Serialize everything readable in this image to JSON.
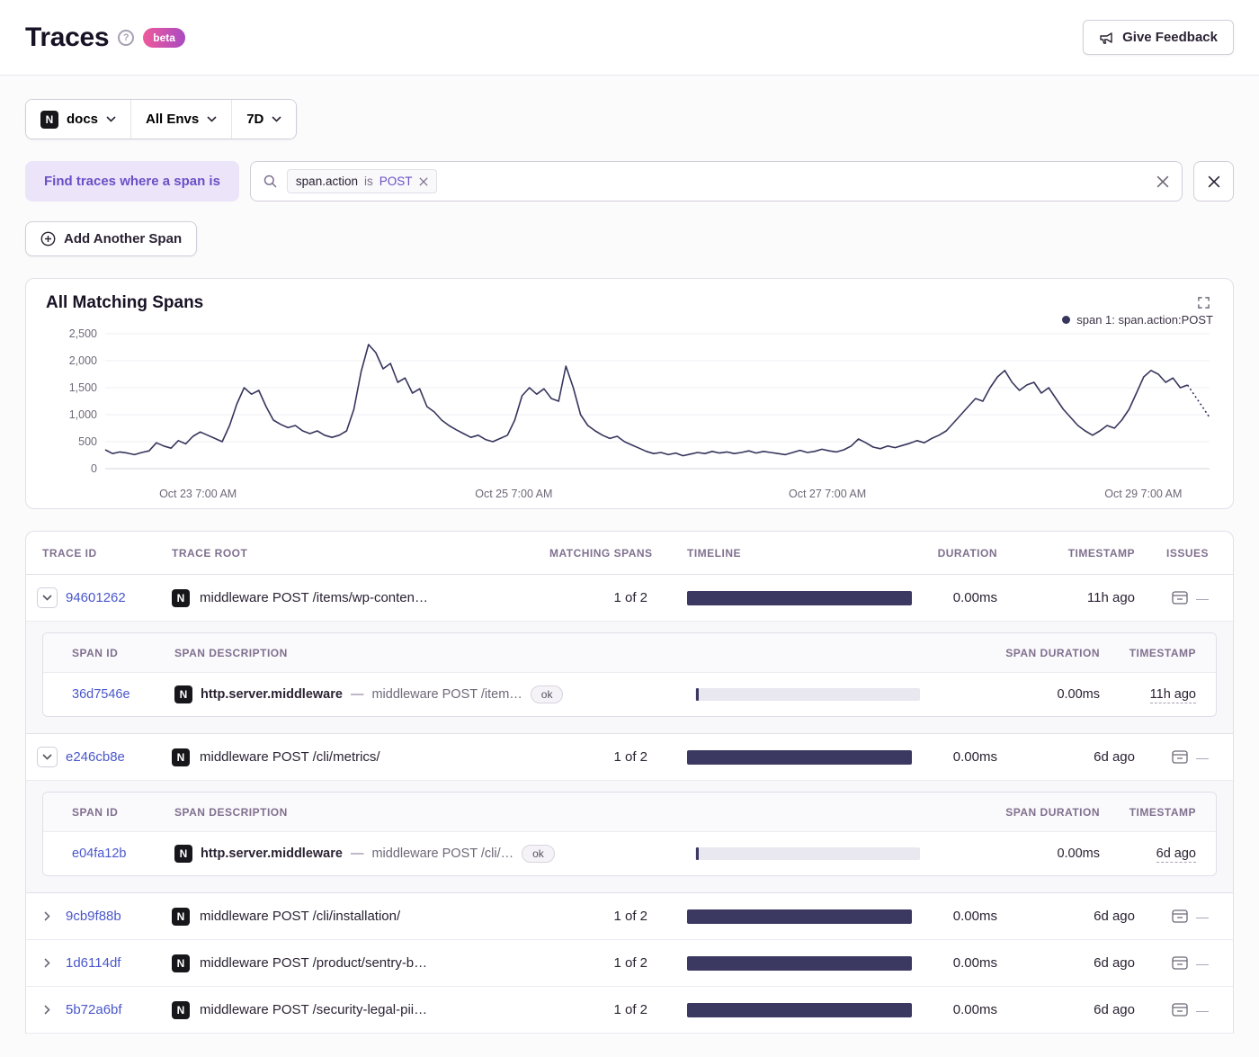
{
  "header": {
    "title": "Traces",
    "beta": "beta",
    "feedback": "Give Feedback"
  },
  "icons": {
    "help": "?",
    "project_letter": "N"
  },
  "filters": {
    "project": "docs",
    "env": "All Envs",
    "range": "7D"
  },
  "span_query": {
    "label": "Find traces where a span is",
    "token": {
      "key": "span.action",
      "op": "is",
      "value": "POST"
    },
    "add_span": "Add Another Span"
  },
  "chart": {
    "title": "All Matching Spans",
    "legend": "span 1: span.action:POST"
  },
  "chart_data": {
    "type": "line",
    "title": "All Matching Spans",
    "xlabel": "",
    "ylabel": "",
    "ylim": [
      0,
      2500
    ],
    "grid": true,
    "legend_position": "top-right",
    "color": "#36355c",
    "y_ticks": [
      0,
      500,
      1000,
      1500,
      2000,
      2500
    ],
    "y_tick_labels": [
      "0",
      "500",
      "1,000",
      "1,500",
      "2,000",
      "2,500"
    ],
    "x_tick_labels": [
      "Oct 23 7:00 AM",
      "Oct 25 7:00 AM",
      "Oct 27 7:00 AM",
      "Oct 29 7:00 AM"
    ],
    "x_tick_fractions": [
      0.084,
      0.37,
      0.654,
      0.94
    ],
    "dashed_tail_points": 4,
    "series": [
      {
        "name": "span 1: span.action:POST",
        "values": [
          350,
          280,
          310,
          290,
          260,
          300,
          330,
          480,
          420,
          380,
          520,
          460,
          600,
          680,
          620,
          560,
          500,
          800,
          1200,
          1500,
          1380,
          1450,
          1150,
          900,
          820,
          760,
          800,
          700,
          650,
          700,
          620,
          580,
          620,
          700,
          1100,
          1800,
          2300,
          2150,
          1850,
          1950,
          1600,
          1680,
          1400,
          1480,
          1150,
          1050,
          900,
          800,
          720,
          650,
          580,
          620,
          540,
          500,
          560,
          620,
          900,
          1350,
          1500,
          1380,
          1480,
          1300,
          1250,
          1900,
          1500,
          1000,
          800,
          700,
          620,
          560,
          600,
          500,
          440,
          380,
          320,
          280,
          300,
          260,
          290,
          240,
          270,
          300,
          280,
          320,
          290,
          310,
          280,
          300,
          330,
          290,
          320,
          300,
          280,
          260,
          300,
          340,
          300,
          320,
          360,
          330,
          310,
          350,
          420,
          550,
          480,
          400,
          370,
          420,
          390,
          430,
          470,
          520,
          480,
          560,
          620,
          700,
          850,
          1000,
          1150,
          1300,
          1250,
          1500,
          1700,
          1820,
          1600,
          1450,
          1550,
          1600,
          1400,
          1500,
          1300,
          1100,
          950,
          800,
          700,
          620,
          700,
          800,
          750,
          900,
          1100,
          1400,
          1700,
          1820,
          1750,
          1600,
          1680,
          1500,
          1550,
          1350,
          1150,
          950
        ]
      }
    ]
  },
  "table": {
    "headers": [
      "TRACE ID",
      "TRACE ROOT",
      "MATCHING SPANS",
      "TIMELINE",
      "DURATION",
      "TIMESTAMP",
      "ISSUES"
    ],
    "sub_headers": [
      "SPAN ID",
      "SPAN DESCRIPTION",
      "SPAN DURATION",
      "TIMESTAMP"
    ],
    "issues_placeholder": "—",
    "desc_separator": "—",
    "rows": [
      {
        "expanded": true,
        "trace_id": "94601262",
        "trace_root": "middleware POST /items/wp-conten…",
        "matching_spans": "1 of 2",
        "duration": "0.00ms",
        "timestamp": "11h ago",
        "spans": [
          {
            "span_id": "36d7546e",
            "op": "http.server.middleware",
            "description": "middleware POST /item…",
            "status": "ok",
            "duration": "0.00ms",
            "timestamp": "11h ago"
          }
        ]
      },
      {
        "expanded": true,
        "trace_id": "e246cb8e",
        "trace_root": "middleware POST /cli/metrics/",
        "matching_spans": "1 of 2",
        "duration": "0.00ms",
        "timestamp": "6d ago",
        "spans": [
          {
            "span_id": "e04fa12b",
            "op": "http.server.middleware",
            "description": "middleware POST /cli/…",
            "status": "ok",
            "duration": "0.00ms",
            "timestamp": "6d ago"
          }
        ]
      },
      {
        "expanded": false,
        "trace_id": "9cb9f88b",
        "trace_root": "middleware POST /cli/installation/",
        "matching_spans": "1 of 2",
        "duration": "0.00ms",
        "timestamp": "6d ago",
        "spans": []
      },
      {
        "expanded": false,
        "trace_id": "1d6114df",
        "trace_root": "middleware POST /product/sentry-b…",
        "matching_spans": "1 of 2",
        "duration": "0.00ms",
        "timestamp": "6d ago",
        "spans": []
      },
      {
        "expanded": false,
        "trace_id": "5b72a6bf",
        "trace_root": "middleware POST /security-legal-pii…",
        "matching_spans": "1 of 2",
        "duration": "0.00ms",
        "timestamp": "6d ago",
        "spans": []
      }
    ]
  },
  "colors": {
    "link": "#4a57cb",
    "timeline_bar": "#3b3861",
    "chart_line": "#36355c",
    "span_label_bg": "#ece5f9",
    "span_label_text": "#6a4fc6",
    "beta_gradient_start": "#ef5a9b",
    "beta_gradient_end": "#a94ac1"
  }
}
